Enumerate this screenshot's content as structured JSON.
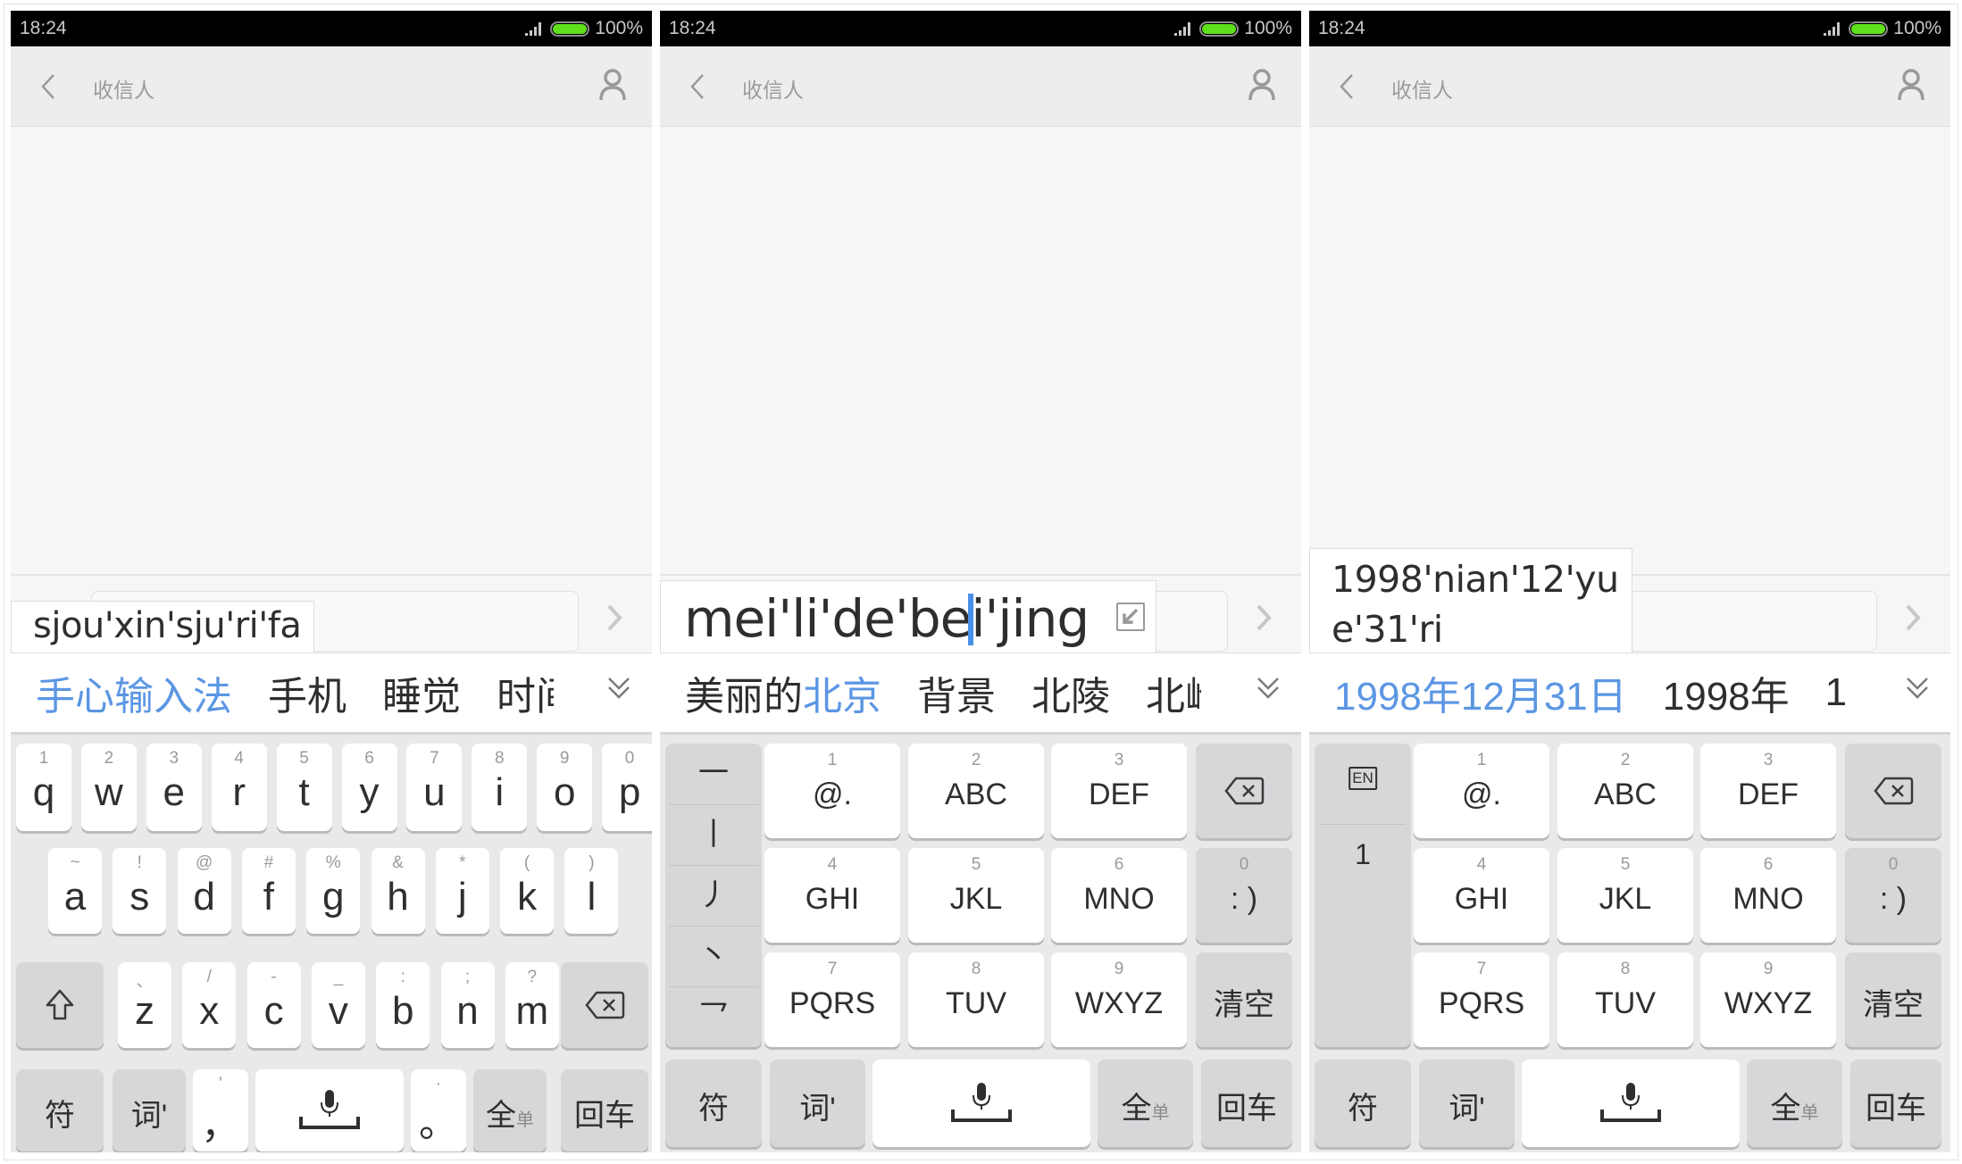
{
  "status_bar": {
    "time": "18:24",
    "battery": "100%",
    "battery_level": 1.0
  },
  "header": {
    "title": "收信人",
    "back_icon": "chevron-left-icon",
    "contact_icon": "person-icon"
  },
  "colors": {
    "accent": "#5b96e3",
    "battery": "#5ee01a",
    "status_bg": "#000000",
    "key_bg": "#ffffff",
    "fn_key_bg": "#d6d7d9",
    "keyboard_bg": "#e8e9eb"
  },
  "panels": [
    {
      "layout": "qwerty",
      "pinyin": "sjou'xin'sju'ri'fa",
      "candidates": [
        "手心输入法",
        "手机",
        "睡觉",
        "时间"
      ],
      "keyboard": {
        "row1": [
          {
            "sub": "1",
            "main": "q"
          },
          {
            "sub": "2",
            "main": "w"
          },
          {
            "sub": "3",
            "main": "e"
          },
          {
            "sub": "4",
            "main": "r"
          },
          {
            "sub": "5",
            "main": "t"
          },
          {
            "sub": "6",
            "main": "y"
          },
          {
            "sub": "7",
            "main": "u"
          },
          {
            "sub": "8",
            "main": "i"
          },
          {
            "sub": "9",
            "main": "o"
          },
          {
            "sub": "0",
            "main": "p"
          }
        ],
        "row2": [
          {
            "sub": "~",
            "main": "a"
          },
          {
            "sub": "!",
            "main": "s"
          },
          {
            "sub": "@",
            "main": "d"
          },
          {
            "sub": "#",
            "main": "f"
          },
          {
            "sub": "%",
            "main": "g"
          },
          {
            "sub": "&",
            "main": "h"
          },
          {
            "sub": "*",
            "main": "j"
          },
          {
            "sub": "(",
            "main": "k"
          },
          {
            "sub": ")",
            "main": "l"
          }
        ],
        "row3": [
          {
            "sub": "、",
            "main": "z"
          },
          {
            "sub": "/",
            "main": "x"
          },
          {
            "sub": "-",
            "main": "c"
          },
          {
            "sub": "_",
            "main": "v"
          },
          {
            "sub": ":",
            "main": "b"
          },
          {
            "sub": ";",
            "main": "n"
          },
          {
            "sub": "?",
            "main": "m"
          }
        ],
        "shift_icon": "shift-icon",
        "backspace_icon": "backspace-icon",
        "symbol": "符",
        "word": "词'",
        "comma": {
          "sub": "'",
          "main": "，"
        },
        "period": {
          "sub": "·",
          "main": "。"
        },
        "space_icon": "mic-space-icon",
        "width_main": "全",
        "width_sub": "单",
        "enter": "回车"
      }
    },
    {
      "layout": "t9-stroke",
      "pinyin_before_cursor": "mei'li'de'be",
      "pinyin_after_cursor": "i'jing",
      "collapse_icon": "collapse-arrow-icon",
      "candidates": [
        {
          "plain": "美丽的",
          "highlight": "北京"
        },
        {
          "plain": "背景",
          "highlight": ""
        },
        {
          "plain": "北陵",
          "highlight": ""
        },
        {
          "plain": "北岭",
          "highlight": ""
        }
      ],
      "strokes": [
        "一",
        "丨",
        "丿",
        "丶",
        "乛"
      ],
      "keyboard": {
        "keys": [
          {
            "sub": "1",
            "main": "@."
          },
          {
            "sub": "2",
            "main": "ABC"
          },
          {
            "sub": "3",
            "main": "DEF"
          },
          {
            "sub": "4",
            "main": "GHI"
          },
          {
            "sub": "5",
            "main": "JKL"
          },
          {
            "sub": "6",
            "main": "MNO"
          },
          {
            "sub": "7",
            "main": "PQRS"
          },
          {
            "sub": "8",
            "main": "TUV"
          },
          {
            "sub": "9",
            "main": "WXYZ"
          }
        ],
        "zero": {
          "sub": "0",
          "main": ": )"
        },
        "clear": "清空",
        "symbol": "符",
        "word": "词'",
        "width_main": "全",
        "width_sub": "单",
        "enter": "回车"
      }
    },
    {
      "layout": "t9-number",
      "pinyin_line1": "1998'nian'12'yu",
      "pinyin_line2": "e'31'ri",
      "candidates": [
        "1998年12月31日",
        "1998年",
        "1"
      ],
      "left_column": {
        "en_label": "EN",
        "item": "1"
      },
      "keyboard": {
        "keys": [
          {
            "sub": "1",
            "main": "@."
          },
          {
            "sub": "2",
            "main": "ABC"
          },
          {
            "sub": "3",
            "main": "DEF"
          },
          {
            "sub": "4",
            "main": "GHI"
          },
          {
            "sub": "5",
            "main": "JKL"
          },
          {
            "sub": "6",
            "main": "MNO"
          },
          {
            "sub": "7",
            "main": "PQRS"
          },
          {
            "sub": "8",
            "main": "TUV"
          },
          {
            "sub": "9",
            "main": "WXYZ"
          }
        ],
        "zero": {
          "sub": "0",
          "main": ": )"
        },
        "clear": "清空",
        "symbol": "符",
        "word": "词'",
        "width_main": "全",
        "width_sub": "单",
        "enter": "回车"
      }
    }
  ]
}
